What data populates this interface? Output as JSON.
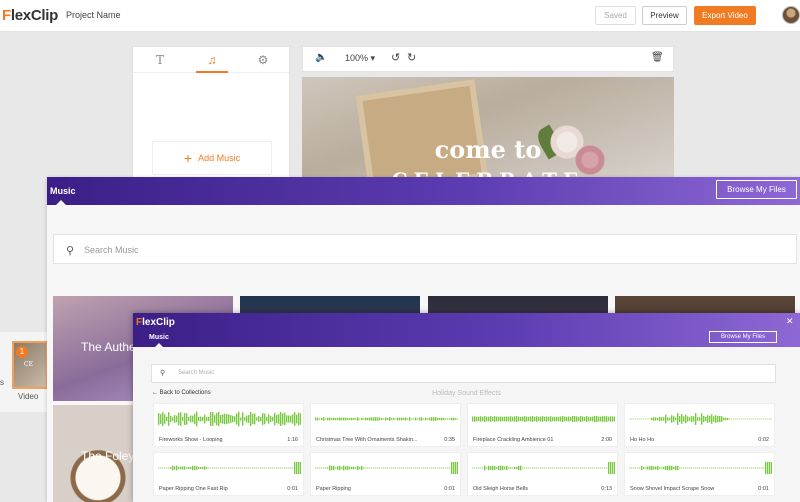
{
  "topbar": {
    "logo_mark": "F",
    "logo_rest": "lexClip",
    "project_name": "Project Name",
    "saved_label": "Saved",
    "preview_label": "Preview",
    "export_label": "Export Video"
  },
  "tools": {
    "tabs": [
      {
        "icon": "text-icon",
        "glyph": "T"
      },
      {
        "icon": "music-note-icon",
        "glyph": "♫"
      },
      {
        "icon": "settings-icon",
        "glyph": "⚙"
      }
    ],
    "add_music_plus": "+",
    "add_music_label": "Add Music"
  },
  "editor": {
    "volume_glyph": "🔈",
    "zoom": "100%",
    "zoom_caret": "▾",
    "undo_glyph": "↺",
    "redo_glyph": "↻",
    "trash_glyph": "🗑",
    "canvas_title": "come to",
    "canvas_subtitle": "CELEBRATE"
  },
  "timeline": {
    "clip_number": "1",
    "clip_label": "Video",
    "clip_text": "CE",
    "side_text": "s"
  },
  "music_window": {
    "title": "Music",
    "browse_label": "Browse My Files",
    "search_glyph": "⚲",
    "search_placeholder": "Search Music",
    "categories": [
      {
        "label": "The Authe"
      },
      {
        "label": "The Foley S"
      }
    ]
  },
  "inner_window": {
    "logo_mark": "F",
    "logo_rest": "lexClip",
    "title": "Music",
    "browse_label": "Browse My Files",
    "close_glyph": "✕",
    "search_glyph": "⚲",
    "search_placeholder": "Search Music",
    "back_label": "← Back to Collections",
    "collection_title": "Holiday Sound Effects",
    "wave_color": "#7ac943",
    "sounds": [
      {
        "name": "Fireworks Show - Looping",
        "duration": "1:16"
      },
      {
        "name": "Christmas Tree With Ornaments Shakin...",
        "duration": "0:35"
      },
      {
        "name": "Fireplace Crackling Ambience 01",
        "duration": "2:00"
      },
      {
        "name": "Ho Ho Ho",
        "duration": "0:02"
      },
      {
        "name": "Paper Ripping One Fast Rip",
        "duration": "0:01"
      },
      {
        "name": "Paper Ripping",
        "duration": "0:01"
      },
      {
        "name": "Old Sleigh Horse Bells",
        "duration": "0:13"
      },
      {
        "name": "Snow Shovel Impact Scrape Snow",
        "duration": "0:01"
      }
    ]
  },
  "colors": {
    "accent": "#f07b22",
    "header_start": "#3b1f86",
    "header_end": "#8e68d4"
  }
}
